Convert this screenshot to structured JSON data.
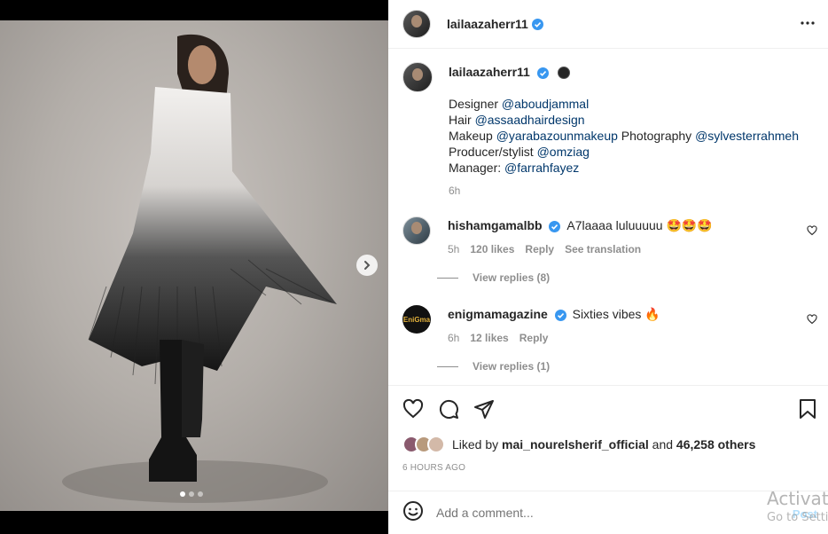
{
  "post": {
    "username": "lailaazaherr11",
    "more_icon": "more-horizontal-icon"
  },
  "caption": {
    "username": "lailaazaherr11",
    "lines": [
      {
        "label": "Designer ",
        "handle": "@aboudjammal",
        "extra": "",
        "handle2": ""
      },
      {
        "label": "Hair ",
        "handle": "@assaadhairdesign",
        "extra": "",
        "handle2": ""
      },
      {
        "label": "Makeup ",
        "handle": "@yarabazounmakeup",
        "extra": " Photography ",
        "handle2": "@sylvesterrahmeh"
      },
      {
        "label": "Producer/stylist ",
        "handle": "@omziag",
        "extra": "",
        "handle2": ""
      },
      {
        "label": "Manager: ",
        "handle": "@farrahfayez",
        "extra": "",
        "handle2": ""
      }
    ],
    "time": "6h"
  },
  "comments": [
    {
      "username": "hishamgamalbb",
      "text": "A7laaaa luluuuuu 🤩🤩🤩",
      "time": "5h",
      "likes": "120 likes",
      "reply": "Reply",
      "translate": "See translation",
      "view_replies": "View replies (8)"
    },
    {
      "username": "enigmamagazine",
      "text": "Sixties vibes 🔥",
      "time": "6h",
      "likes": "12 likes",
      "reply": "Reply",
      "view_replies": "View replies (1)",
      "avatar_text": "EniGma"
    }
  ],
  "likes": {
    "prefix": "Liked by ",
    "user": "mai_nourelsherif_official",
    "middle": " and ",
    "count": "46,258 others"
  },
  "timestamp": "6 HOURS AGO",
  "add_comment": {
    "placeholder": "Add a comment...",
    "post": "Post"
  },
  "carousel": {
    "slides": 3,
    "active": 1
  },
  "watermark": {
    "line1": "Activate",
    "line2": "Go to Setti"
  },
  "colors": {
    "link": "#00376b",
    "verified": "#3897f0",
    "muted": "#8e8e8e"
  }
}
